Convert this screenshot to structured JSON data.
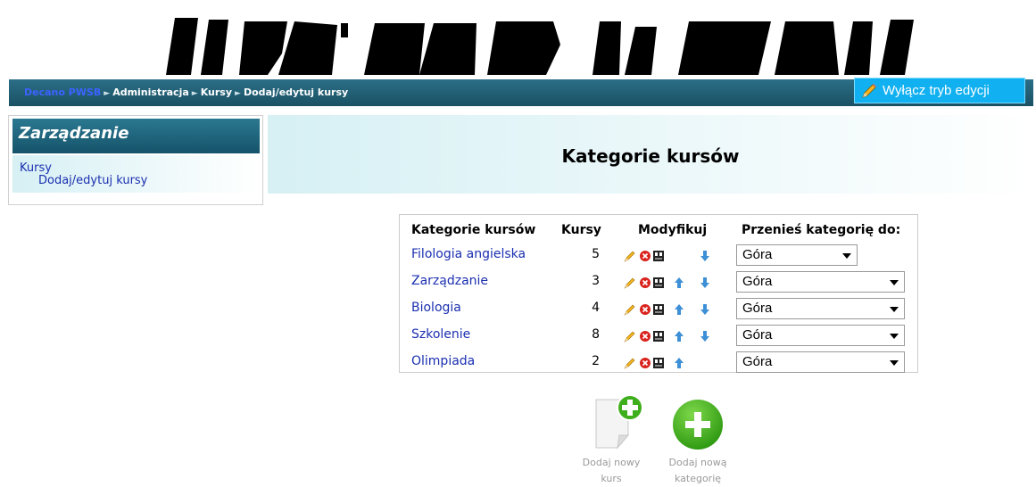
{
  "breadcrumb": {
    "home": "Decano PWSB",
    "separator": "►",
    "items": [
      "Administracja",
      "Kursy",
      "Dodaj/edytuj kursy"
    ]
  },
  "edit_button": {
    "label": "Wyłącz tryb edycji",
    "icon": "pencil-icon"
  },
  "sidebar": {
    "title": "Zarządzanie",
    "items": [
      {
        "label": "Kursy"
      },
      {
        "label": "Dodaj/edytuj kursy"
      }
    ]
  },
  "main": {
    "title": "Kategorie kursów"
  },
  "table": {
    "headers": {
      "category": "Kategorie kursów",
      "courses": "Kursy",
      "modify": "Modyfikuj",
      "move": "Przenieś kategorię do:"
    },
    "rows": [
      {
        "name": "Filologia angielska",
        "count": "5",
        "move_to": "Góra",
        "up": false,
        "down": true
      },
      {
        "name": "Zarządzanie",
        "count": "3",
        "move_to": "Góra",
        "up": true,
        "down": true
      },
      {
        "name": "Biologia",
        "count": "4",
        "move_to": "Góra",
        "up": true,
        "down": true
      },
      {
        "name": "Szkolenie",
        "count": "8",
        "move_to": "Góra",
        "up": true,
        "down": true
      },
      {
        "name": "Olimpiada",
        "count": "2",
        "move_to": "Góra",
        "up": true,
        "down": false
      }
    ],
    "row_icons": [
      "edit-pencil-icon",
      "delete-icon",
      "hide-icon",
      "move-up-icon",
      "move-down-icon"
    ]
  },
  "actions": {
    "add_course": {
      "line1": "Dodaj nowy",
      "line2": "kurs"
    },
    "add_category": {
      "line1": "Dodaj nową",
      "line2": "kategorię"
    }
  },
  "colors": {
    "navbar": "#1f5f74",
    "link": "#1a2fb0",
    "edit_button": "#11b0f0",
    "add_green": "#3fae1d"
  }
}
